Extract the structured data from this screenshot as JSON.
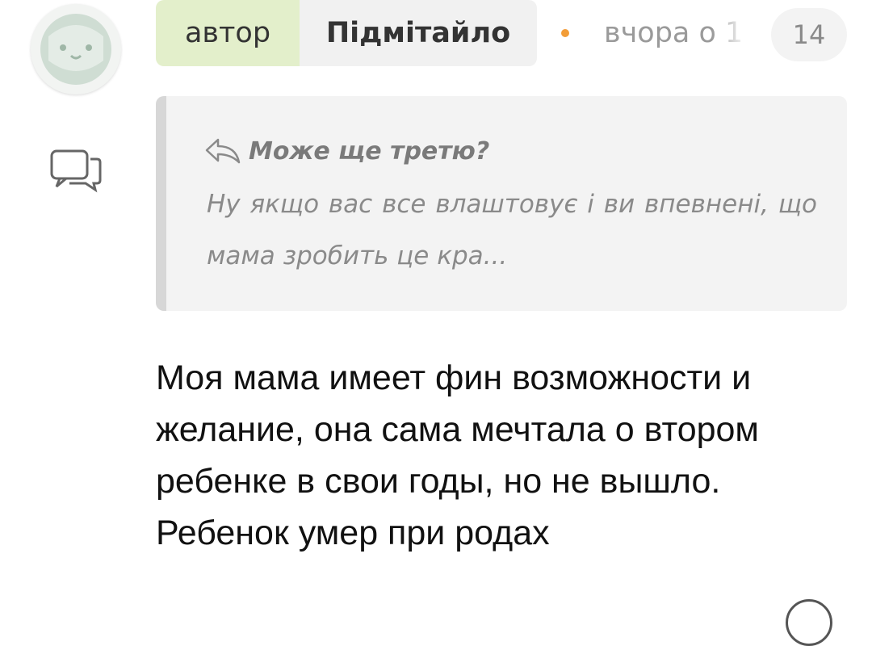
{
  "comment": {
    "author_badge": "автор",
    "username": "Підмітайло",
    "timestamp": "вчора о 1",
    "likes_count": "14",
    "message": "Моя мама имеет фин возможности и желание, она сама мечтала о втором ребенке в свои годы, но не вышло. Ребенок умер при родах"
  },
  "quote": {
    "title": "Може ще третю?",
    "text": "Ну якщо вас все влаштовує і ви впевнені, що мама зробить це кра..."
  },
  "icons": {
    "avatar": "owl-avatar-icon",
    "comment": "comment-bubbles-icon",
    "reply": "reply-arrow-icon"
  },
  "colors": {
    "author_badge_bg": "#e3efcb",
    "dot": "#f29d38",
    "quote_bg": "#f3f3f3"
  }
}
